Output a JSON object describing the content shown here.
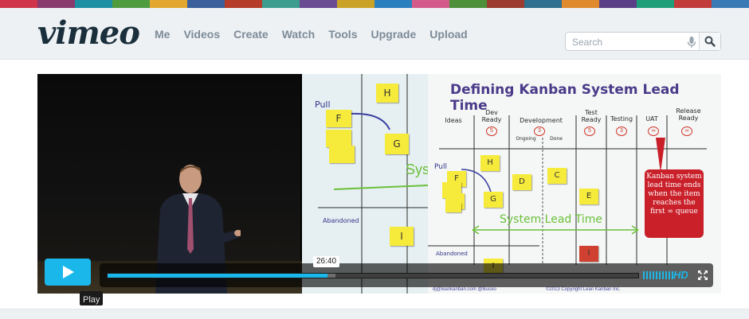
{
  "brand": {
    "logo_text": "vimeo",
    "strip_colors": [
      "#d0344a",
      "#8a3b6e",
      "#1c8fa3",
      "#4f9c3f",
      "#e3a72f",
      "#3a5f9a",
      "#b53c2a",
      "#3c9d8f",
      "#6a4c93",
      "#c9a227",
      "#2a7fbf",
      "#d45a8a",
      "#4e8f3a",
      "#9c3b2f",
      "#2f6f8f",
      "#e08a2e",
      "#5b3f86",
      "#1f9e7a",
      "#c23b3b",
      "#3a7ab5"
    ]
  },
  "nav": {
    "items": [
      "Me",
      "Videos",
      "Create",
      "Watch",
      "Tools",
      "Upgrade",
      "Upload"
    ]
  },
  "search": {
    "placeholder": "Search",
    "mic_icon": "microphone-icon",
    "button_icon": "magnifier-icon"
  },
  "slide": {
    "title": "Defining Kanban System Lead Time",
    "columns": [
      "Ideas",
      "Dev Ready",
      "Development",
      "Test Ready",
      "Testing",
      "UAT",
      "Release Ready"
    ],
    "sub_columns": [
      "Ongoing",
      "Done"
    ],
    "wip_limits": [
      "5",
      "3",
      "5",
      "3",
      "∞",
      "∞"
    ],
    "notes": [
      "H",
      "F",
      "G",
      "D",
      "C",
      "E",
      "I",
      "I"
    ],
    "pull_label": "Pull",
    "lead_time_label": "System Lead Time",
    "abandoned_label": "Abandoned",
    "callout": "Kanban system lead time ends when the item reaches the first ∞ queue",
    "footer_left": "dj@leankanban.com @lkuceo",
    "footer_right": "©2013 Copyright Lean Kanban Inc."
  },
  "left_slide": {
    "pull_label": "Pull",
    "notes": [
      "H",
      "F",
      "G",
      "I"
    ],
    "abandoned_label": "Abandoned",
    "partial_label": "Sys"
  },
  "player": {
    "time_tooltip": "26:40",
    "progress": 0.415,
    "loaded": 0.43,
    "hd_label": "HD",
    "play_tooltip": "Play",
    "accent": "#1ab7ea"
  }
}
